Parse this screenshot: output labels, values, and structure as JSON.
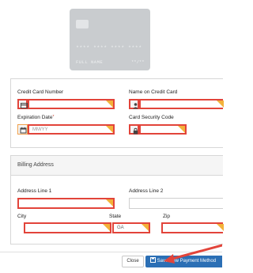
{
  "card_preview": {
    "number_mask": "**** **** **** ****",
    "name_placeholder": "FULL NAME",
    "expiry_mask": "**/**"
  },
  "payment_panel": {
    "card_number_label": "Credit Card Number",
    "name_label": "Name on Credit Card",
    "expiration_label": "Expiration Date",
    "expiration_required_marker": "*",
    "expiration_placeholder": "MM/YY",
    "security_code_label": "Card Security Code"
  },
  "billing_panel": {
    "title": "Billing Address",
    "address1_label": "Address Line 1",
    "address2_label": "Address Line 2",
    "city_label": "City",
    "state_label": "State",
    "state_value": "GA",
    "zip_label": "Zip"
  },
  "footer": {
    "close_label": "Close",
    "save_label": "Save New Payment Method"
  },
  "colors": {
    "error_border": "#e2443a",
    "warning_flag": "#f3b23a",
    "primary_button": "#2b6fb5",
    "annotation_arrow": "#e2443a"
  },
  "icons": {
    "card_number": "credit-card-icon",
    "name": "user-icon",
    "expiration": "calendar-icon",
    "security_code": "lock-icon",
    "save": "save-icon"
  }
}
